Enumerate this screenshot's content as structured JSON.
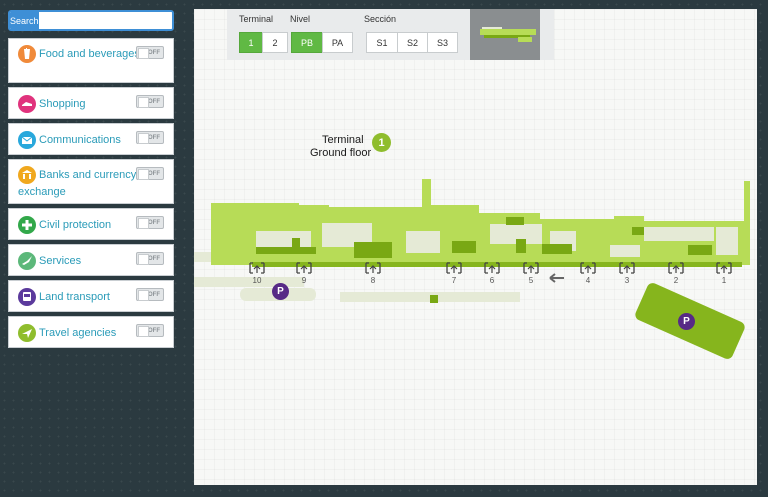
{
  "sidebar": {
    "search_button": "Search",
    "search_placeholder": "",
    "toggle_off_label": "OFF",
    "items": [
      {
        "label": "Food and beverages",
        "icon": "food-icon",
        "color": "#f08a3a"
      },
      {
        "label": "Shopping",
        "icon": "shopping-icon",
        "color": "#e0337d"
      },
      {
        "label": "Communications",
        "icon": "communications-icon",
        "color": "#29a8dc"
      },
      {
        "label": "Banks and currency exchange",
        "icon": "bank-icon",
        "color": "#f0a81e"
      },
      {
        "label": "Civil protection",
        "icon": "civil-protection-icon",
        "color": "#32a84a"
      },
      {
        "label": "Services",
        "icon": "services-icon",
        "color": "#5cb87a"
      },
      {
        "label": "Land transport",
        "icon": "land-transport-icon",
        "color": "#5b3a9c"
      },
      {
        "label": "Travel agencies",
        "icon": "travel-agencies-icon",
        "color": "#8fbd2d"
      }
    ]
  },
  "controls": {
    "terminal_label": "Terminal",
    "terminal_options": [
      "1",
      "2"
    ],
    "terminal_selected": "1",
    "nivel_label": "Nivel",
    "nivel_options": [
      "PB",
      "PA"
    ],
    "nivel_selected": "PB",
    "seccion_label": "Sección",
    "seccion_options": [
      "S1",
      "S2",
      "S3"
    ]
  },
  "map": {
    "title_line1": "Terminal",
    "title_line2": "Ground floor",
    "terminal_badge": "1",
    "gates": [
      "10",
      "9",
      "8",
      "7",
      "6",
      "5",
      "4",
      "3",
      "2",
      "1"
    ],
    "parking_label": "P",
    "colors": {
      "building_light": "#b7dc57",
      "building_dark": "#79a814",
      "floor_pale": "#e5ead6",
      "parking": "#572a86",
      "accent_green": "#60b944"
    }
  }
}
